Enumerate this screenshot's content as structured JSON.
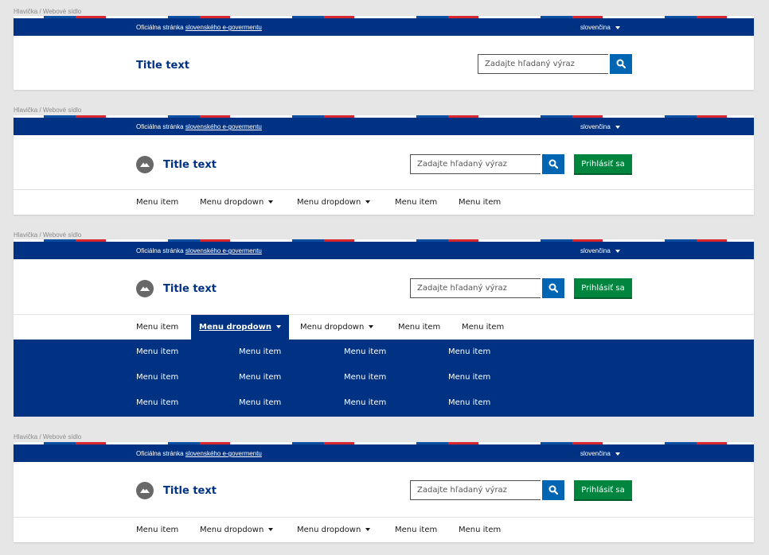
{
  "frames": [
    {
      "label": "Hlavička / Webové sídlo",
      "official_text": "Oficiálna stránka ",
      "official_link": "slovenského e-govermentu",
      "language": "slovenčina",
      "title": "Title text",
      "search_placeholder": "Zadajte hľadaný výraz"
    },
    {
      "label": "Hlavička / Webové sídlo",
      "official_text": "Oficiálna stránka ",
      "official_link": "slovenského e-govermentu",
      "language": "slovenčina",
      "title": "Title text",
      "search_placeholder": "Zadajte hľadaný výraz",
      "login": "Prihlásiť sa",
      "menu": [
        "Menu item",
        "Menu dropdown",
        "Menu dropdown",
        "Menu item",
        "Menu item"
      ]
    },
    {
      "label": "Hlavička / Webové sídlo",
      "official_text": "Oficiálna stránka ",
      "official_link": "slovenského e-govermentu",
      "language": "slovenčina",
      "title": "Title text",
      "search_placeholder": "Zadajte hľadaný výraz",
      "login": "Prihlásiť sa",
      "menu": [
        "Menu item",
        "Menu dropdown",
        "Menu dropdown",
        "Menu item",
        "Menu item"
      ],
      "dropdown_items": [
        [
          "Menu item",
          "Menu item",
          "Menu item",
          "Menu item"
        ],
        [
          "Menu item",
          "Menu item",
          "Menu item",
          "Menu item"
        ],
        [
          "Menu item",
          "Menu item",
          "Menu item",
          "Menu item"
        ]
      ]
    },
    {
      "label": "Hlavička / Webové sídlo",
      "official_text": "Oficiálna stránka ",
      "official_link": "slovenského e-govermentu",
      "language": "slovenčina",
      "title": "Title text",
      "search_placeholder": "Zadajte hľadaný výraz",
      "login": "Prihlásiť sa",
      "menu": [
        "Menu item",
        "Menu dropdown",
        "Menu dropdown",
        "Menu item",
        "Menu item"
      ]
    }
  ],
  "colors": {
    "brand_blue": "#003283",
    "search_blue": "#0065b3",
    "login_green": "#00853f",
    "flag_red": "#d7262e",
    "logo_gray": "#686868"
  },
  "icons": {
    "search": "search-icon",
    "logo": "mountain-logo-icon",
    "caret": "caret-down-icon"
  }
}
